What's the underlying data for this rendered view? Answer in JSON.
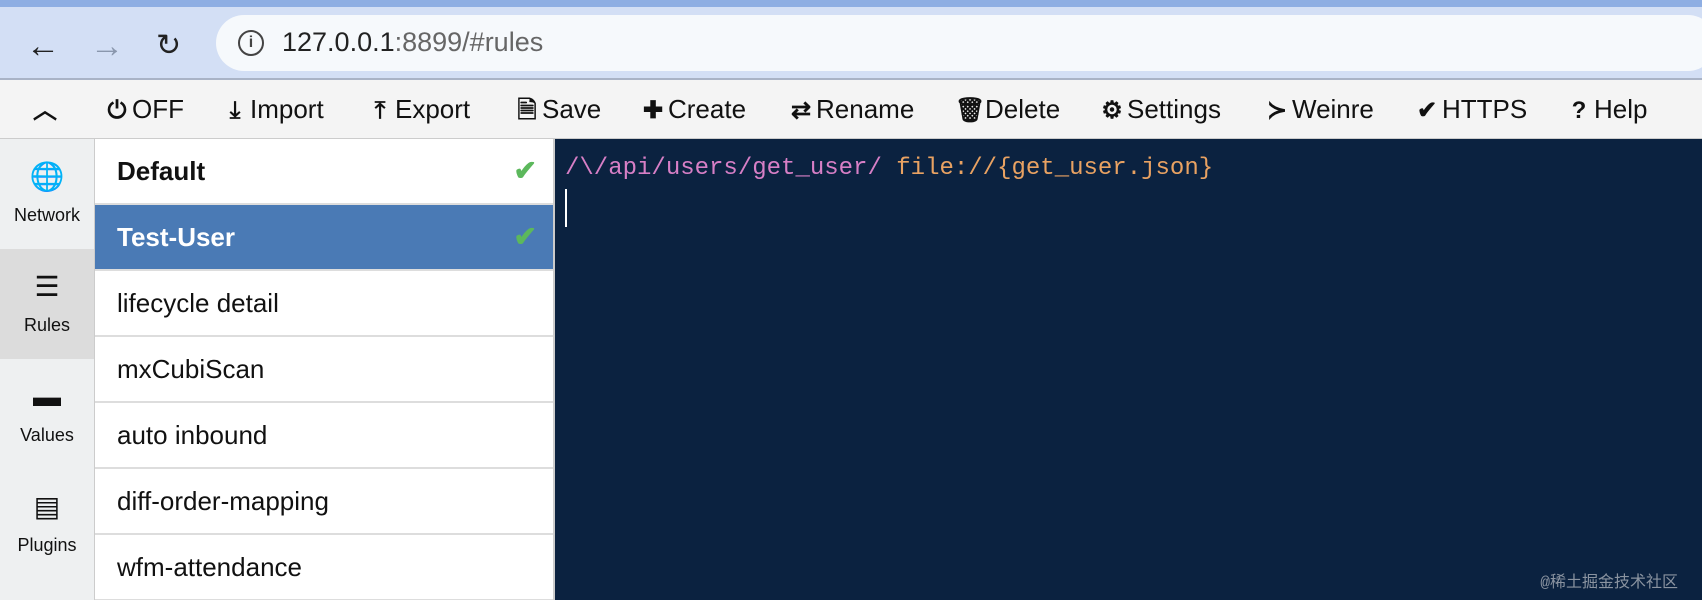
{
  "browser": {
    "url_host": "127.0.0.1",
    "url_rest": ":8899/#rules"
  },
  "toolbar": {
    "items": [
      {
        "label": "OFF",
        "icon": "power-icon"
      },
      {
        "label": "Import",
        "icon": "import-icon"
      },
      {
        "label": "Export",
        "icon": "export-icon"
      },
      {
        "label": "Save",
        "icon": "save-icon"
      },
      {
        "label": "Create",
        "icon": "plus-icon"
      },
      {
        "label": "Rename",
        "icon": "exchange-icon"
      },
      {
        "label": "Delete",
        "icon": "trash-icon"
      },
      {
        "label": "Settings",
        "icon": "gear-icon"
      },
      {
        "label": "Weinre",
        "icon": "terminal-icon"
      },
      {
        "label": "HTTPS",
        "icon": "check-icon"
      },
      {
        "label": "Help",
        "icon": "question-icon"
      }
    ]
  },
  "nav": {
    "items": [
      {
        "label": "Network"
      },
      {
        "label": "Rules"
      },
      {
        "label": "Values"
      },
      {
        "label": "Plugins"
      }
    ]
  },
  "rules": {
    "items": [
      {
        "name": "Default"
      },
      {
        "name": "Test-User"
      },
      {
        "name": "lifecycle detail"
      },
      {
        "name": "mxCubiScan"
      },
      {
        "name": "auto inbound"
      },
      {
        "name": "diff-order-mapping"
      },
      {
        "name": "wfm-attendance"
      }
    ],
    "check": "✔"
  },
  "editor": {
    "pattern": "/\\/api/users/get_user/",
    "value": "file://{get_user.json}"
  },
  "watermark": "@稀土掘金技术社区",
  "colors": {
    "selected": "#4a7ab5",
    "editor_bg": "#0b2240",
    "pattern": "#d77fc6",
    "value": "#e9a262",
    "check": "#5cb85c"
  }
}
